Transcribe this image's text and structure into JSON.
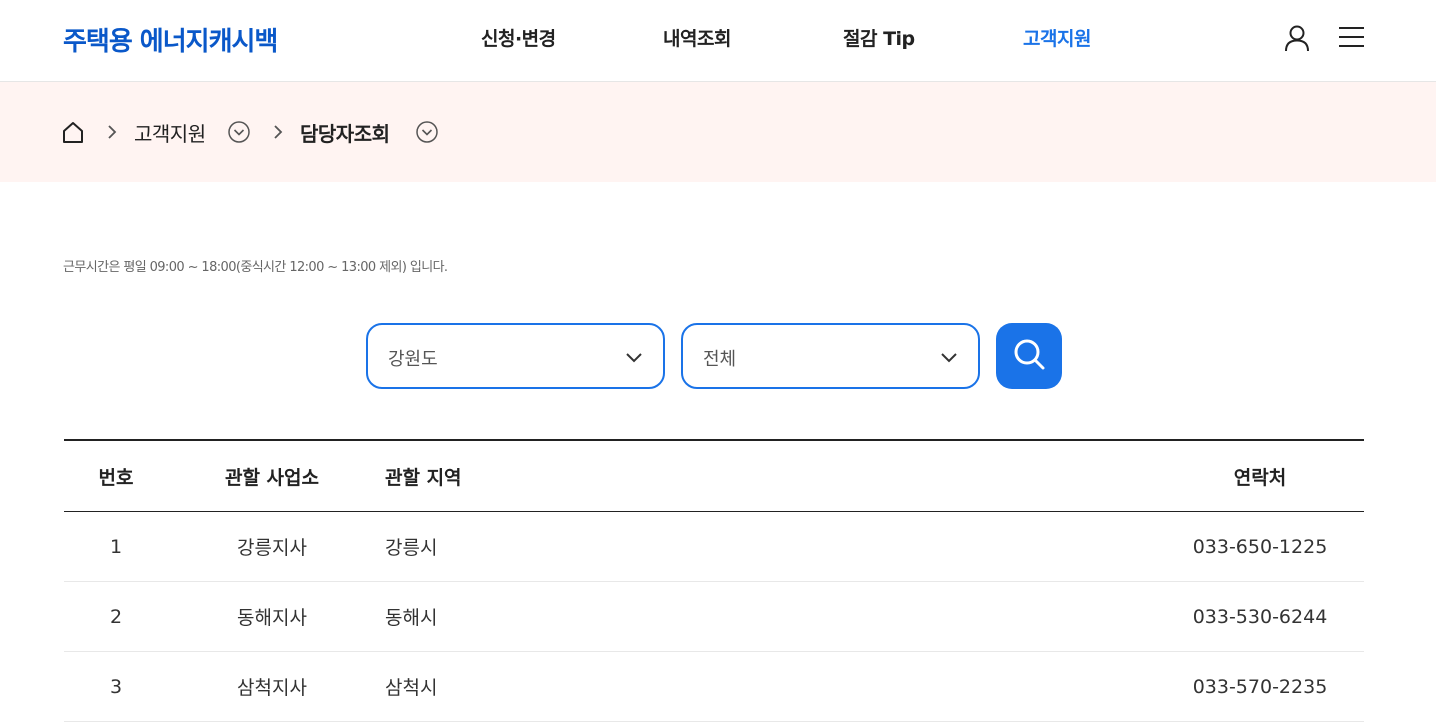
{
  "header": {
    "logo": "주택용 에너지캐시백",
    "nav": [
      {
        "label": "신청·변경",
        "active": false
      },
      {
        "label": "내역조회",
        "active": false
      },
      {
        "label": "절감 Tip",
        "active": false
      },
      {
        "label": "고객지원",
        "active": true
      }
    ],
    "icons": [
      "user-icon",
      "menu-icon"
    ]
  },
  "breadcrumb": {
    "home_icon": "home-icon",
    "level1": "고객지원",
    "level2": "담당자조회"
  },
  "notice": "근무시간은 평일 09:00 ~ 18:00(중식시간 12:00 ~ 13:00 제외) 입니다.",
  "search": {
    "region_select": "강원도",
    "district_select": "전체",
    "button_icon": "search-icon"
  },
  "table": {
    "headers": {
      "no": "번호",
      "office": "관할 사업소",
      "area": "관할 지역",
      "tel": "연락처"
    },
    "rows": [
      {
        "no": "1",
        "office": "강릉지사",
        "area": "강릉시",
        "tel": "033-650-1225"
      },
      {
        "no": "2",
        "office": "동해지사",
        "area": "동해시",
        "tel": "033-530-6244"
      },
      {
        "no": "3",
        "office": "삼척지사",
        "area": "삼척시",
        "tel": "033-570-2235"
      }
    ]
  },
  "colors": {
    "brand": "#0a58c9",
    "accent": "#1a73e8",
    "breadcrumb_bg": "#fff4f2"
  }
}
